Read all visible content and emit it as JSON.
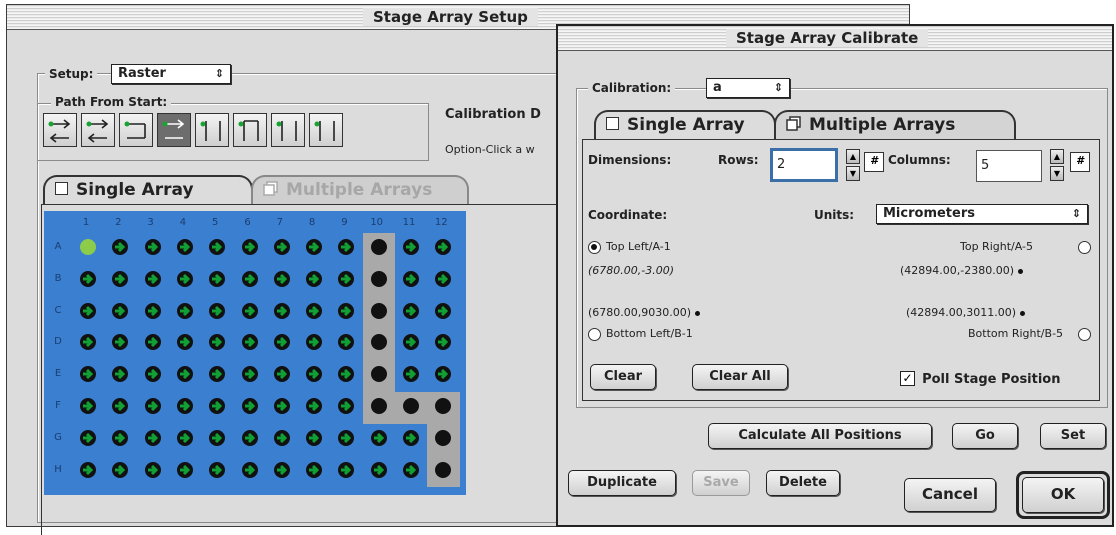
{
  "setup_window": {
    "title": "Stage Array Setup",
    "setup_label": "Setup:",
    "setup_value": "Raster",
    "path_label": "Path From Start:",
    "calib_text": "Calibration D",
    "option_text": "Option-Click a w",
    "tabs": [
      {
        "label": "Single Array",
        "active": true
      },
      {
        "label": "Multiple Arrays",
        "active": false
      }
    ],
    "col_headers": [
      "1",
      "2",
      "3",
      "4",
      "5",
      "6",
      "7",
      "8",
      "9",
      "10",
      "11",
      "12"
    ],
    "row_headers": [
      "A",
      "B",
      "C",
      "D",
      "E",
      "F",
      "G",
      "H"
    ],
    "colors": {
      "grid_bg": "#3b7fd1",
      "well_green": "#11a033",
      "start_well": "#8ccc4a",
      "path_gray": "#a9a9a9"
    }
  },
  "calibrate_window": {
    "title": "Stage Array Calibrate",
    "calibration_label": "Calibration:",
    "calibration_value": "a",
    "tabs": [
      {
        "label": "Single Array",
        "active": true
      },
      {
        "label": "Multiple Arrays",
        "active": false
      }
    ],
    "dimensions_label": "Dimensions:",
    "rows_label": "Rows:",
    "rows_value": "2",
    "columns_label": "Columns:",
    "columns_value": "5",
    "hash_label": "#",
    "coordinate_label": "Coordinate:",
    "units_label": "Units:",
    "units_value": "Micrometers",
    "top_left_label": "Top Left/A-1",
    "top_left_coord": "(6780.00,-3.00)",
    "top_right_label": "Top Right/A-5",
    "top_right_coord": "(42894.00,-2380.00)",
    "bottom_left_coord": "(6780.00,9030.00)",
    "bottom_left_label": "Bottom Left/B-1",
    "bottom_right_coord": "(42894.00,3011.00)",
    "bottom_right_label": "Bottom Right/B-5",
    "selected_corner": "Top Left/A-1",
    "clear_label": "Clear",
    "clear_all_label": "Clear All",
    "poll_label": "Poll Stage Position",
    "poll_checked": true,
    "calculate_label": "Calculate All Positions",
    "go_label": "Go",
    "set_label": "Set",
    "duplicate_label": "Duplicate",
    "save_label": "Save",
    "delete_label": "Delete",
    "cancel_label": "Cancel",
    "ok_label": "OK"
  }
}
